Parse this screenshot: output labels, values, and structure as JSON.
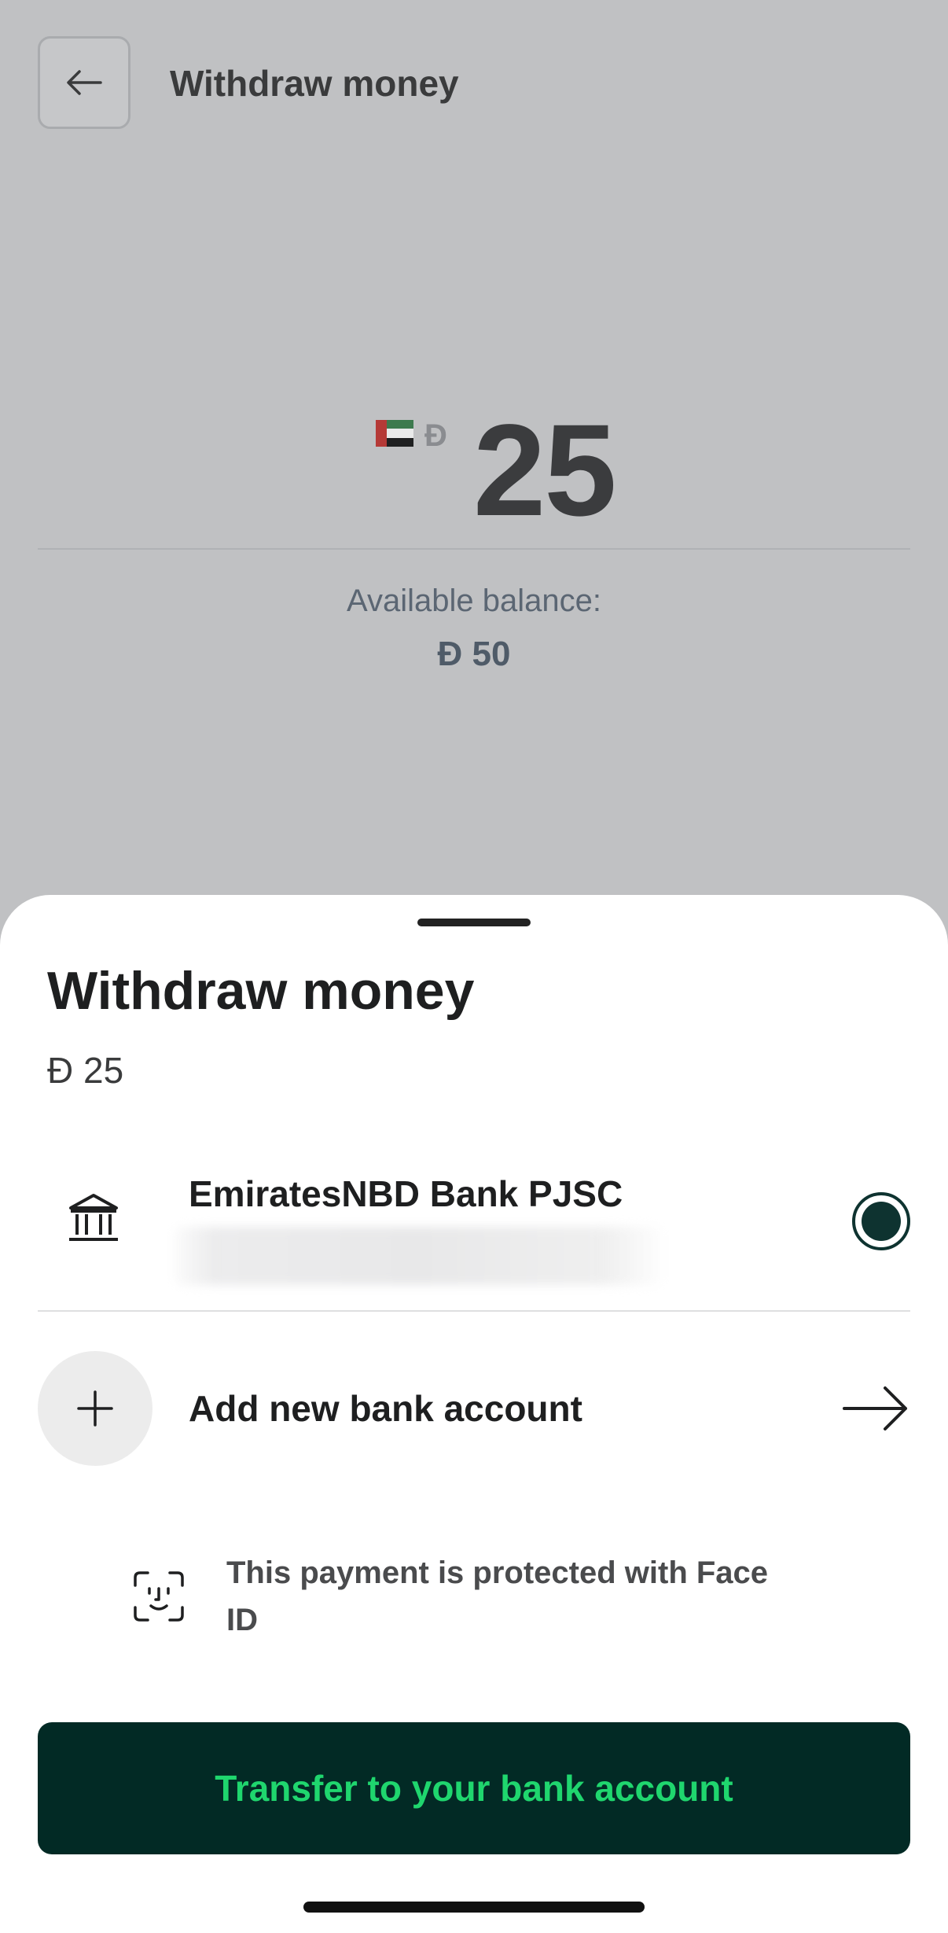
{
  "background": {
    "header": {
      "back_icon": "arrow-left-icon",
      "title": "Withdraw money"
    },
    "amount": {
      "flag": "uae-flag",
      "currency_symbol": "Đ",
      "value": "25"
    },
    "balance": {
      "label": "Available balance:",
      "value": "Đ 50"
    }
  },
  "sheet": {
    "title": "Withdraw money",
    "amount": "Đ 25",
    "bank_account": {
      "icon": "bank-icon",
      "name": "EmiratesNBD Bank PJSC",
      "selected": true
    },
    "add_account": {
      "icon": "plus-icon",
      "label": "Add new bank account",
      "arrow_icon": "arrow-right-icon"
    },
    "face_id": {
      "icon": "face-id-icon",
      "text": "This payment is protected with Face ID"
    },
    "cta_label": "Transfer to your bank account"
  },
  "colors": {
    "primary": "#022a25",
    "cta_text": "#1fd66e",
    "overlay": "#c0c1c3"
  }
}
